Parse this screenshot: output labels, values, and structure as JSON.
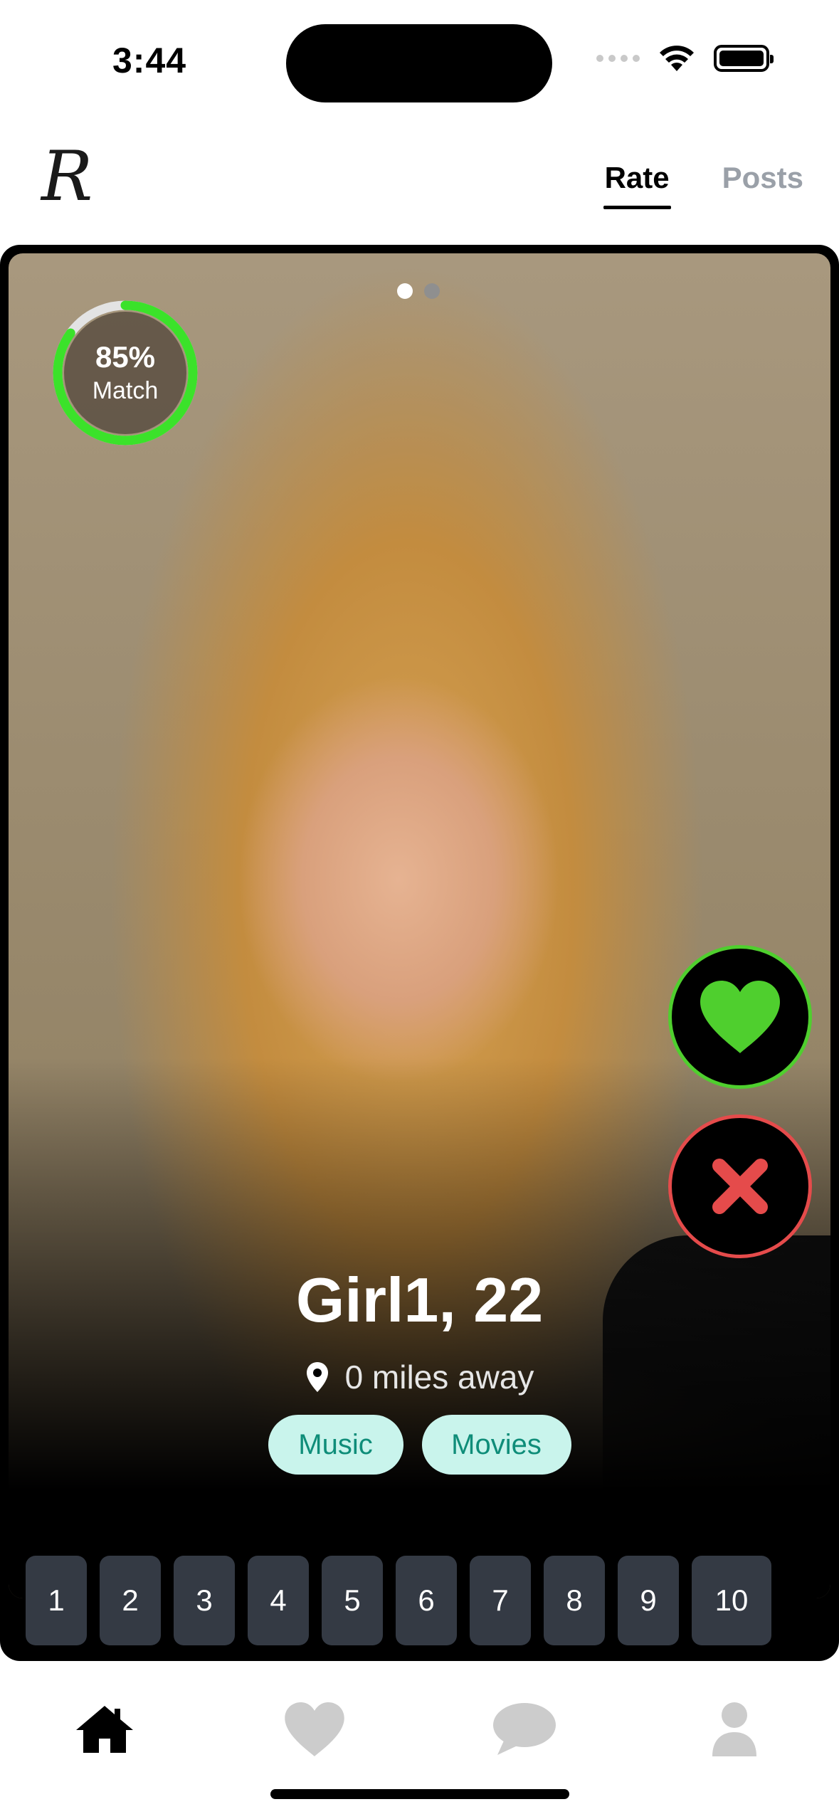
{
  "status_bar": {
    "time": "3:44"
  },
  "header": {
    "logo": "R",
    "tabs": [
      {
        "label": "Rate",
        "active": true
      },
      {
        "label": "Posts",
        "active": false
      }
    ]
  },
  "card": {
    "photo_index": 1,
    "photo_count": 2,
    "match": {
      "percent_text": "85%",
      "percent": 85,
      "label": "Match",
      "ring_color": "#3be22a"
    },
    "name_age": "Girl1, 22",
    "distance": "0 miles away",
    "interests": [
      "Music",
      "Movies"
    ],
    "actions": {
      "like_icon": "heart-icon",
      "like_color": "#4fcf2e",
      "pass_icon": "x-icon",
      "pass_color": "#e54b4b"
    },
    "rating_scale": [
      "1",
      "2",
      "3",
      "4",
      "5",
      "6",
      "7",
      "8",
      "9",
      "10"
    ]
  },
  "bottom_nav": [
    {
      "name": "home",
      "icon": "home-icon",
      "active": true
    },
    {
      "name": "likes",
      "icon": "heart-icon",
      "active": false
    },
    {
      "name": "messages",
      "icon": "chat-icon",
      "active": false
    },
    {
      "name": "profile",
      "icon": "person-icon",
      "active": false
    }
  ]
}
